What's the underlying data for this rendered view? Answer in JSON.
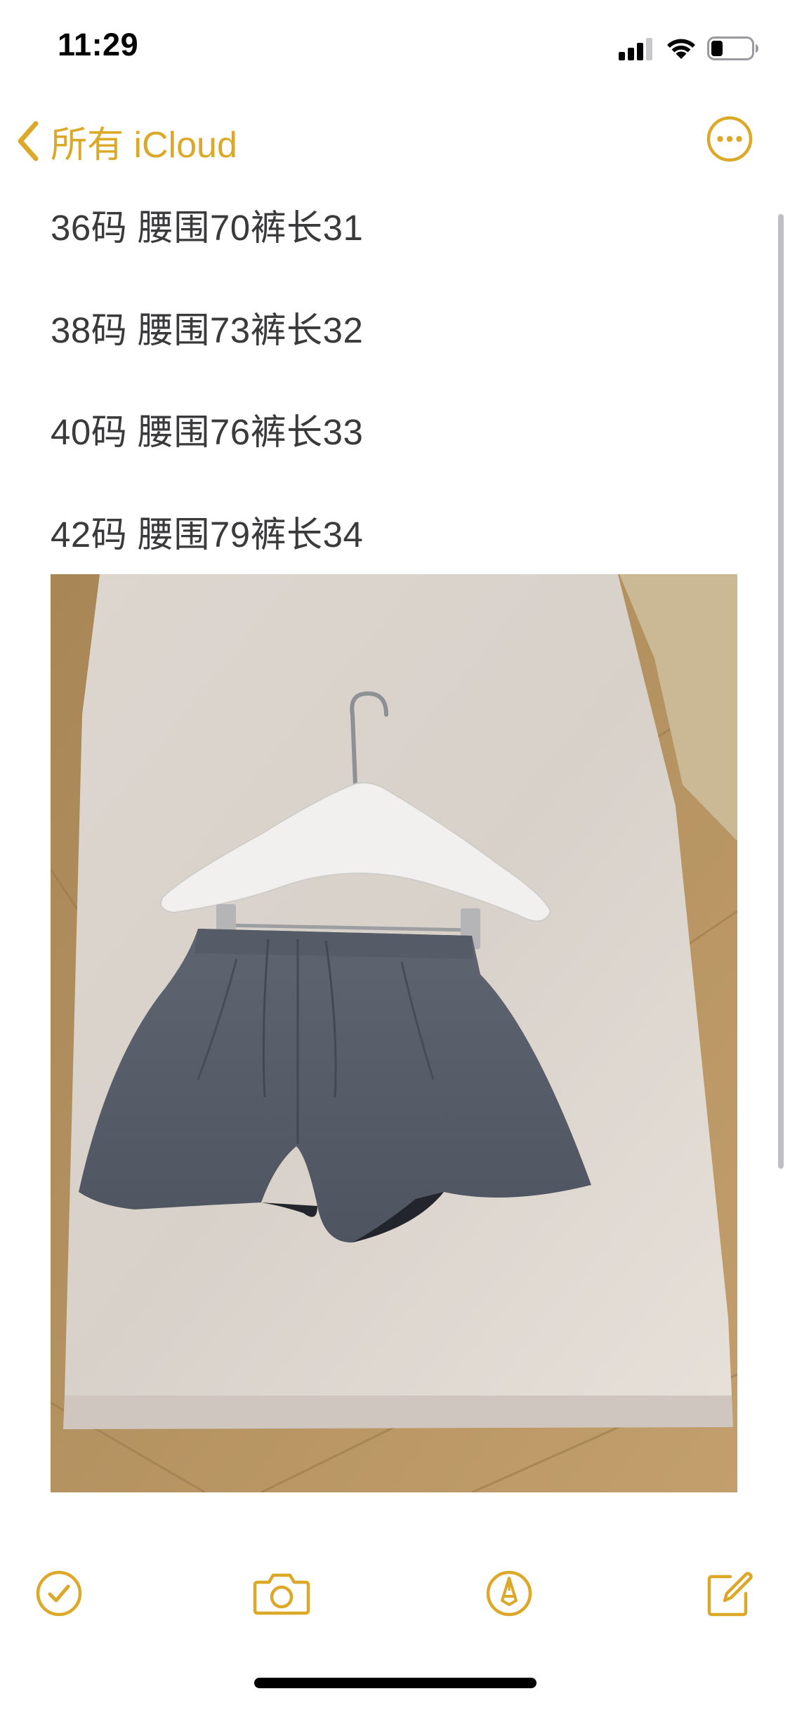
{
  "status_bar": {
    "time": "11:29",
    "icons": [
      "cellular-signal-icon",
      "wifi-icon",
      "battery-icon"
    ]
  },
  "nav": {
    "back_label": "所有 iCloud",
    "back_icon": "chevron-left-icon",
    "more_icon": "ellipsis-circle-icon"
  },
  "note": {
    "lines": [
      "36码 腰围70裤长31",
      "38码 腰围73裤长32",
      "40码 腰围76裤长33",
      "42码 腰围79裤长34"
    ],
    "attachment": {
      "kind": "photo",
      "subject": "grey-wool-shorts-on-hanger"
    }
  },
  "toolbar": {
    "items": [
      "checklist-icon",
      "camera-icon",
      "markup-pen-icon",
      "compose-icon"
    ]
  },
  "colors": {
    "accent": "#DCA828",
    "text": "#3a3a3c",
    "background": "#ffffff"
  }
}
